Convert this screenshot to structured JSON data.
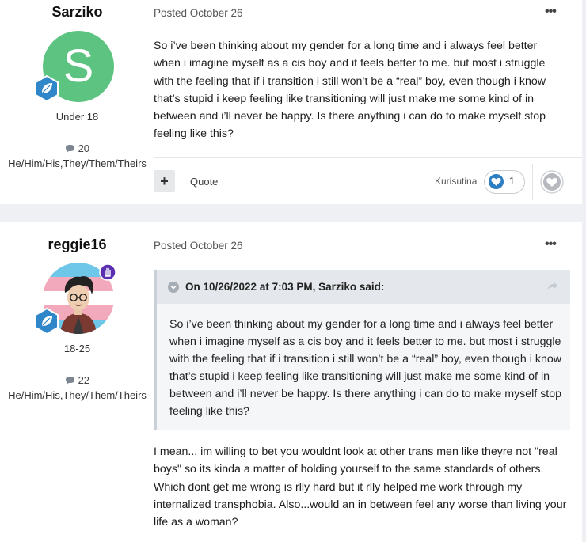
{
  "posts": [
    {
      "author": {
        "username": "Sarziko",
        "avatar_letter": "S",
        "age": "Under 18",
        "post_count": "20",
        "pronouns": "He/Him/His,They/Them/Theirs"
      },
      "posted": "Posted October 26",
      "more_icon": "•••",
      "body": "So i’ve been thinking about my gender for a long time and i always feel better when i imagine myself as a cis boy and it feels better to me. but most i struggle with the feeling that if i transition i still won’t be a “real” boy, even though i know that’s stupid i keep feeling like transitioning will just make me some kind of in between and i’ll never be happy. Is there anything i can do to make myself stop feeling like this?",
      "controls": {
        "plus": "+",
        "quote": "Quote",
        "reactor": "Kurisutina",
        "reaction_count": "1"
      }
    },
    {
      "author": {
        "username": "reggie16",
        "age": "18-25",
        "post_count": "22",
        "pronouns": "He/Him/His,They/Them/Theirs"
      },
      "posted": "Posted October 26",
      "more_icon": "•••",
      "quote": {
        "header": "On 10/26/2022 at 7:03 PM, Sarziko said:",
        "body": "So i’ve been thinking about my gender for a long time and i always feel better when i imagine myself as a cis boy and it feels better to me. but most i struggle with the feeling that if i transition i still won’t be a “real” boy, even though i know that’s stupid i keep feeling like transitioning will just make me some kind of in between and i’ll never be happy. Is there anything i can do to make myself stop feeling like this?"
      },
      "body": "I mean... im willing to bet you wouldnt look at other trans men like theyre not \"real boys\" so its kinda a matter of holding yourself to the same standards of others. Which dont get me wrong is rlly hard but it rlly helped me work through my internalized transphobia. Also...would an in between feel any worse than living your life as a woman?"
    }
  ],
  "colors": {
    "avatar_green": "#5cc480",
    "badge_blue": "#2f86c9",
    "staff_purple": "#5a2fb0",
    "heart_blue": "#2d7fc1"
  },
  "icons": {
    "comment": "comment-icon",
    "badge": "leaf-badge-icon",
    "staff": "hand-badge-icon"
  }
}
